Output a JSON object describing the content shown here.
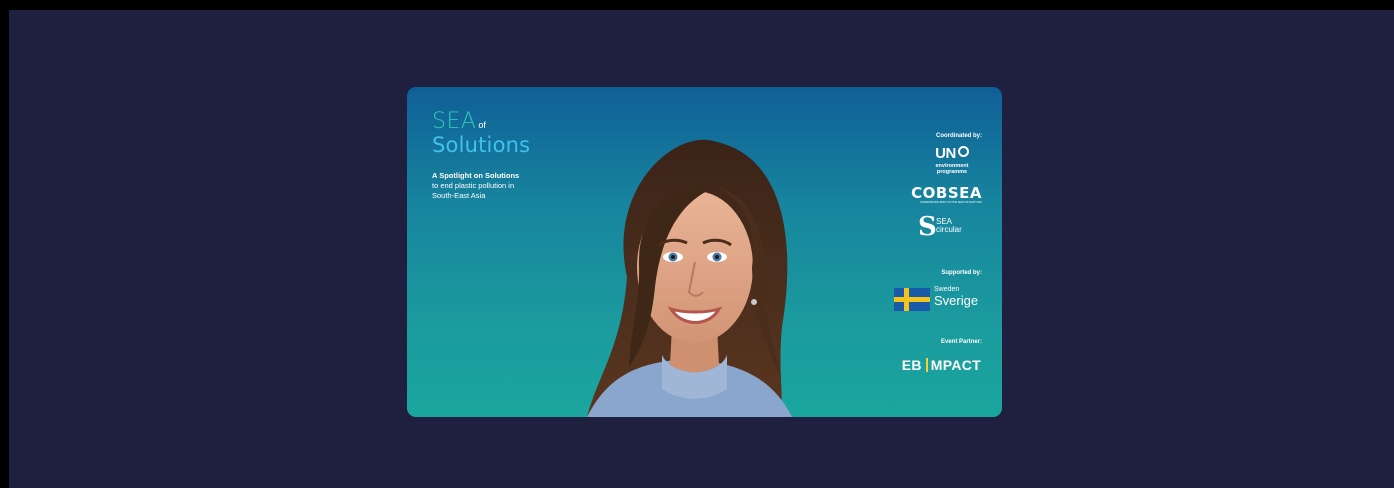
{
  "banner": {
    "title": {
      "sea": "SEA",
      "of": "of",
      "solutions": "Solutions"
    },
    "tagline": {
      "bold": "A Spotlight on Solutions",
      "line1": "to end plastic pollution in",
      "line2": "South-East Asia"
    },
    "coordinated_label": "Coordinated by:",
    "un_logo": {
      "un": "UN",
      "line1": "environment",
      "line2": "programme"
    },
    "cobsea": {
      "name": "COBSEA",
      "sub": "COORDINATING BODY ON THE SEAS OF EAST ASIA"
    },
    "sea_circular": {
      "line1": "SEA",
      "line2": "circular"
    },
    "supported_label": "Supported by:",
    "sweden": {
      "en": "Sweden",
      "sv": "Sverige"
    },
    "partner_label": "Event Partner:",
    "partner": {
      "left": "EB",
      "right": "MPACT"
    },
    "colors": {
      "page_bg": "#1f1f40",
      "sea_green": "#33c7b4",
      "solutions_blue": "#3fc2ee",
      "flag_blue": "#1a5aa8",
      "flag_yellow": "#f3c51c"
    }
  }
}
